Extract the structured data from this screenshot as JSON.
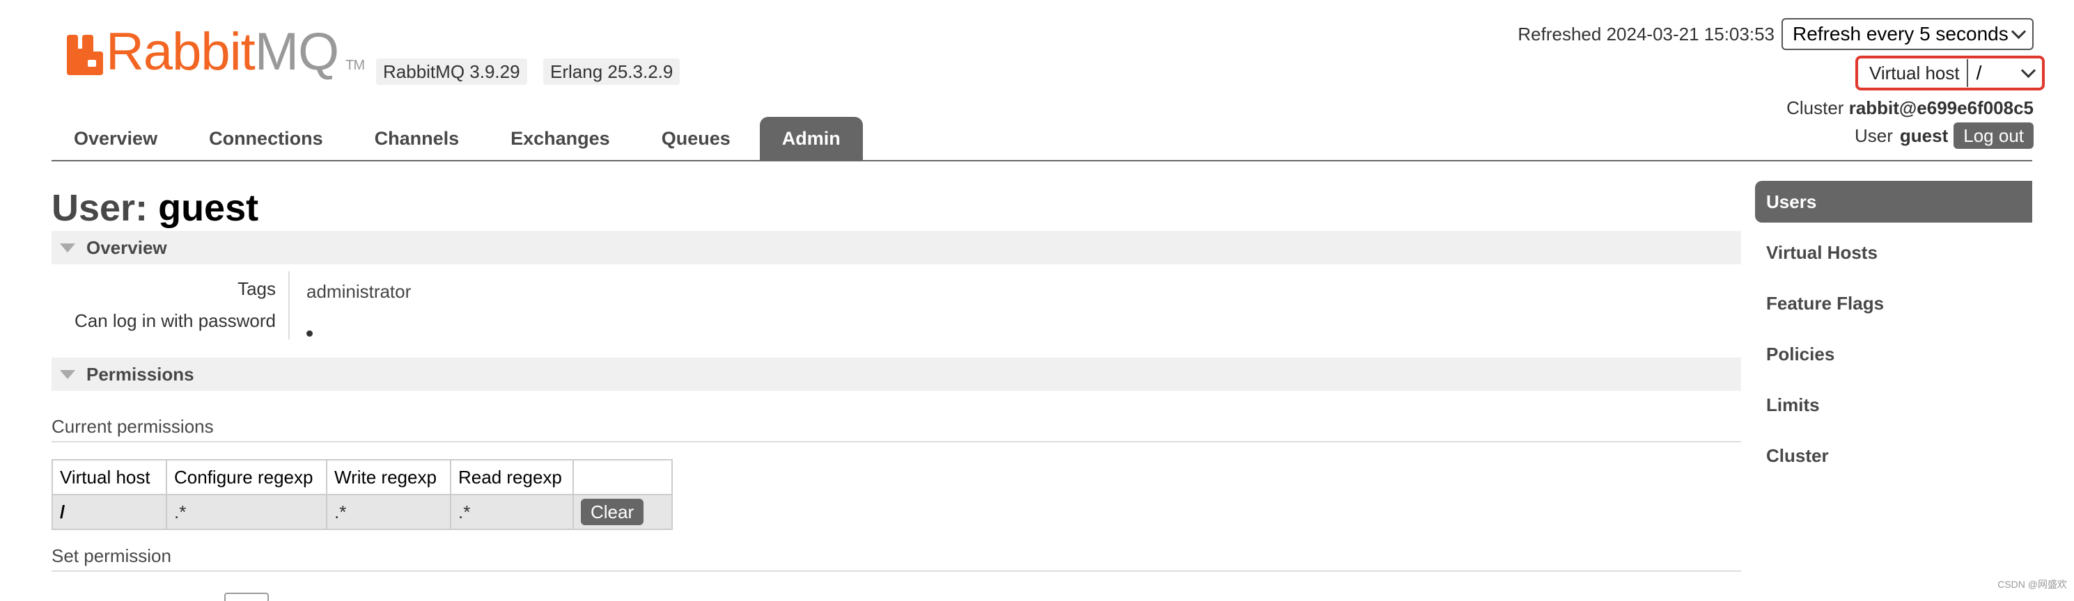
{
  "logo": {
    "rabbit_text": "Rabbit",
    "mq_text": "MQ",
    "tm_text": "TM"
  },
  "versions": {
    "rabbitmq": "RabbitMQ 3.9.29",
    "erlang": "Erlang 25.3.2.9"
  },
  "header": {
    "refreshed_label": "Refreshed 2024-03-21 15:03:53",
    "refresh_select_value": "Refresh every 5 seconds",
    "vhost_label": "Virtual host",
    "vhost_select_value": "/",
    "cluster_label": "Cluster",
    "cluster_name": "rabbit@e699e6f008c5",
    "user_label": "User",
    "user_name": "guest",
    "logout_label": "Log out"
  },
  "nav": {
    "tabs": [
      {
        "label": "Overview"
      },
      {
        "label": "Connections"
      },
      {
        "label": "Channels"
      },
      {
        "label": "Exchanges"
      },
      {
        "label": "Queues"
      },
      {
        "label": "Admin"
      }
    ],
    "active": "Admin"
  },
  "main": {
    "title_prefix": "User:",
    "title_name": "guest",
    "overview_section": "Overview",
    "tags_label": "Tags",
    "tags_value": "administrator",
    "can_login_label": "Can log in with password",
    "permissions_section": "Permissions",
    "current_permissions_heading": "Current permissions",
    "table": {
      "headers": [
        "Virtual host",
        "Configure regexp",
        "Write regexp",
        "Read regexp",
        ""
      ],
      "rows": [
        {
          "vhost": "/",
          "configure": ".*",
          "write": ".*",
          "read": ".*",
          "action": "Clear"
        }
      ]
    },
    "set_permission_heading": "Set permission"
  },
  "sidebar": {
    "items": [
      {
        "label": "Users"
      },
      {
        "label": "Virtual Hosts"
      },
      {
        "label": "Feature Flags"
      },
      {
        "label": "Policies"
      },
      {
        "label": "Limits"
      },
      {
        "label": "Cluster"
      }
    ],
    "active": "Users"
  },
  "watermark": "CSDN @网盛欢",
  "colors": {
    "brand_orange": "#f26522",
    "active_tab_bg": "#666666",
    "highlight_border": "#e0382d"
  }
}
